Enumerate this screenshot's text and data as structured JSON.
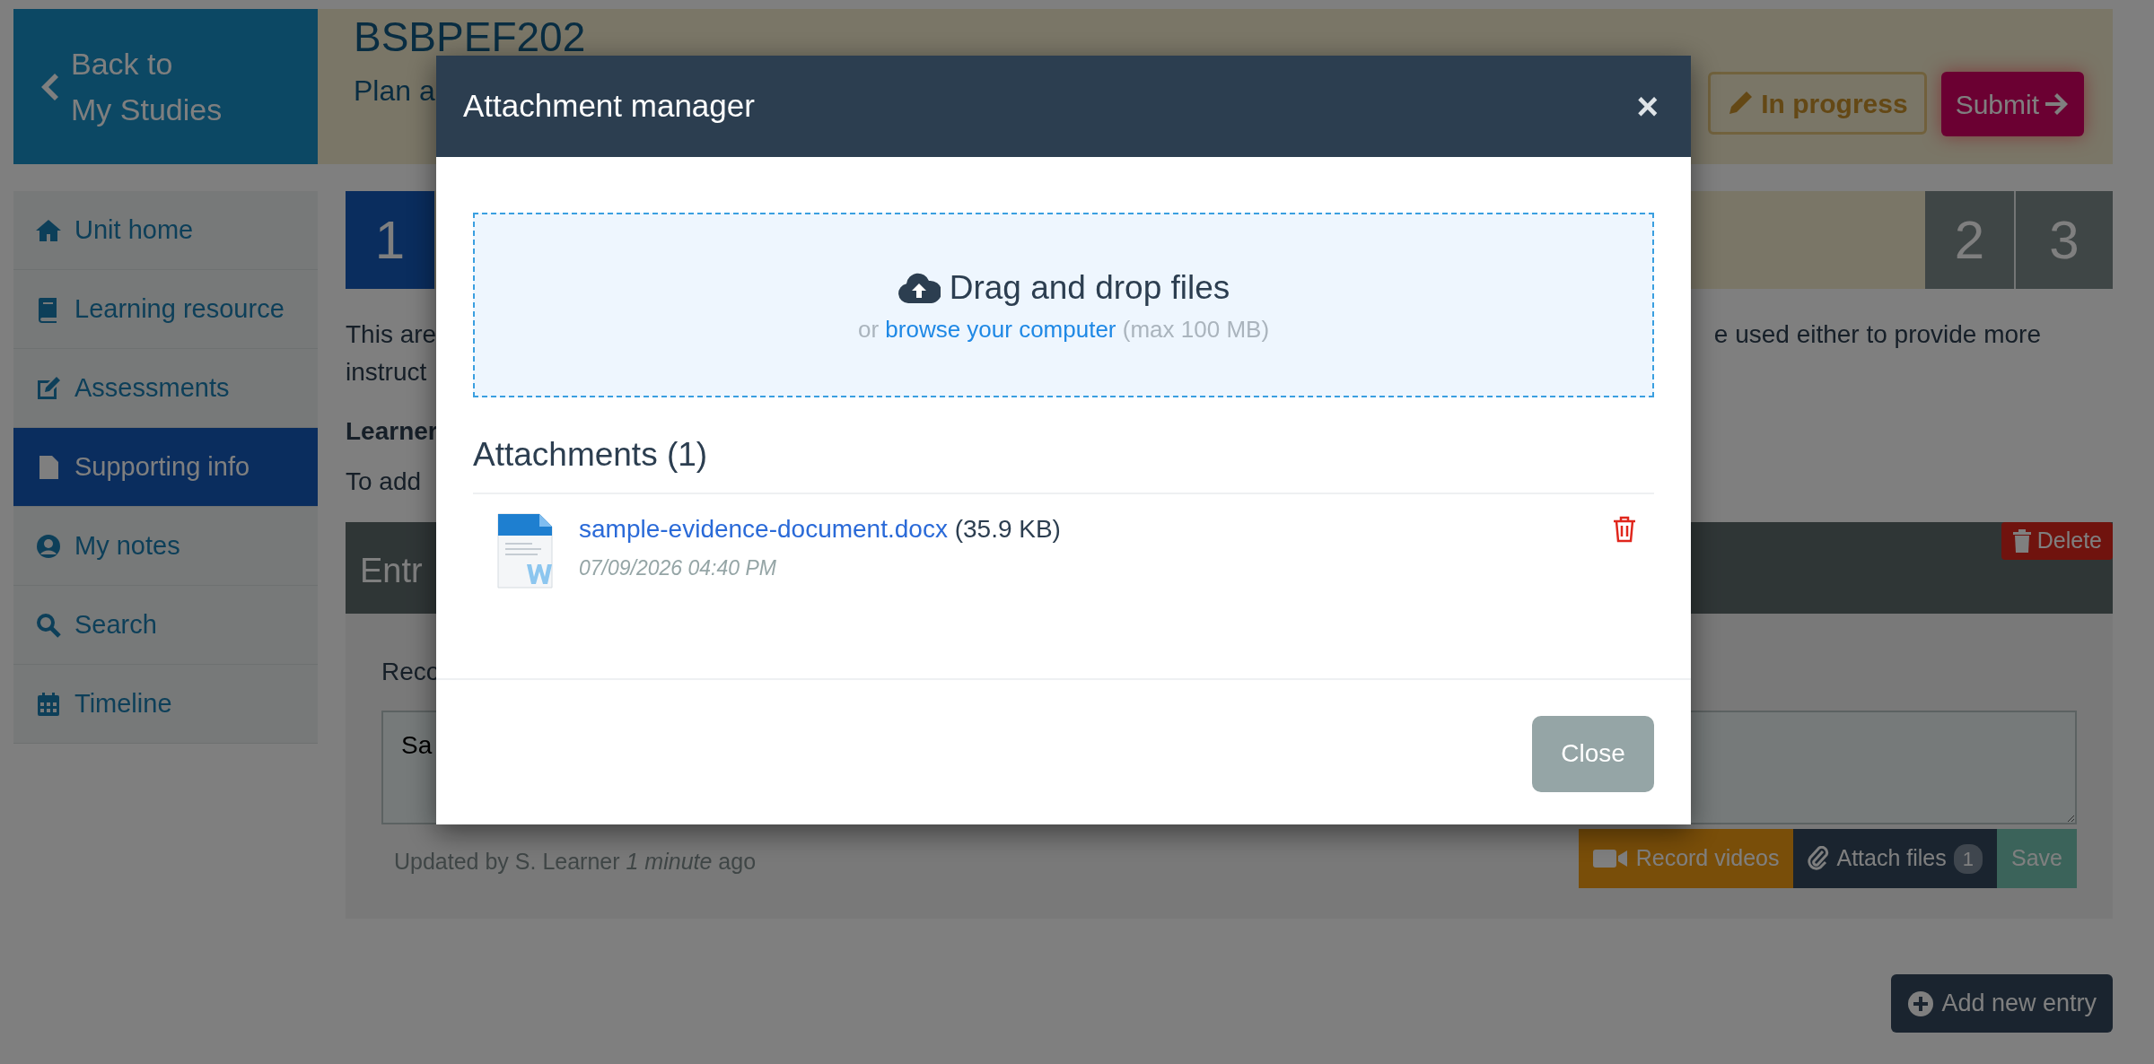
{
  "header": {
    "back_button": [
      "Back to",
      "My Studies"
    ],
    "unit_code": "BSBPEF202",
    "unit_title": "Plan a",
    "status_button": "In progress",
    "submit_button": "Submit"
  },
  "sidebar": {
    "items": [
      {
        "label": "Unit home",
        "selected": false
      },
      {
        "label": "Learning resource",
        "selected": false
      },
      {
        "label": "Assessments",
        "selected": false
      },
      {
        "label": "Supporting info",
        "selected": true
      },
      {
        "label": "My notes",
        "selected": false
      },
      {
        "label": "Search",
        "selected": false
      },
      {
        "label": "Timeline",
        "selected": false
      }
    ]
  },
  "steps": [
    {
      "label": "1",
      "selected": true
    },
    {
      "label": "2",
      "selected": false
    },
    {
      "label": "3",
      "selected": false
    }
  ],
  "intro": {
    "line_1_start": "This are",
    "line_1_end": "e used either to provide more",
    "line_2_start": "instruct"
  },
  "learner_label": "Learner",
  "hint": "To add",
  "entry": {
    "title": "Entr",
    "delete_button": "Delete",
    "field_label": "Reco",
    "value": "Sa",
    "updated": "Updated by S. Learner *1 minute* ago",
    "record_button": "Record videos",
    "attach_button": "Attach files",
    "attach_count": "1",
    "save_button": "Save"
  },
  "add_button": "Add new entry",
  "modal": {
    "title": "Attachment manager",
    "close_icon": "×",
    "dropzone": {
      "title": "Drag and drop files",
      "prefix": "or",
      "link": "browse your computer",
      "limit": "(max 100 MB)"
    },
    "attachments_heading": "Attachments (1)",
    "attachments": [
      {
        "name": "sample-evidence-document.docx",
        "size": "(35.9 KB)",
        "date": "07/09/2026 04:40 PM"
      }
    ],
    "close_button": "Close"
  }
}
